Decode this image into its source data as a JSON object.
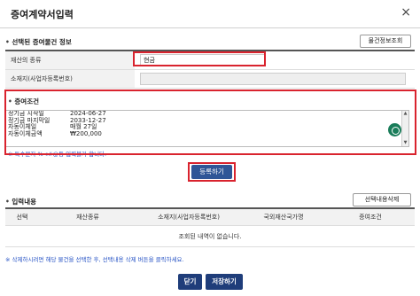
{
  "window": {
    "title": "증여계약서입력",
    "close_label": "×"
  },
  "selected_section": {
    "heading": "선택된 증여물건 정보",
    "lookup_button": "물건정보조회",
    "rows": [
      {
        "label": "재산의 종류",
        "value": "현금"
      },
      {
        "label": "소재지(사업자등록번호)",
        "value": ""
      }
    ]
  },
  "conditions_section": {
    "heading": "증여조건",
    "lines": [
      {
        "key": "정기금 시작일",
        "value": "2024-06-27"
      },
      {
        "key": "정기금 마지막일",
        "value": "2033-12-27"
      },
      {
        "key": "자동이체일",
        "value": "   매월 27일"
      },
      {
        "key": "자동이체금액",
        "value": "₩200,000"
      }
    ],
    "note": "※ 특수문자 %<#@등 입력불가 합니다."
  },
  "register_button": "등록하기",
  "input_section": {
    "heading": "입력내용",
    "delete_button": "선택내용삭제",
    "columns": [
      "선택",
      "재산종류",
      "소재지(사업자등록번호)",
      "국외재산국가명",
      "증여조건"
    ],
    "empty_message": "조회된 내역이 없습니다.",
    "note": "※ 삭제하시려면 해당 물건을 선택한 후, 선택내용 삭제 버튼을 클릭하세요."
  },
  "footer": {
    "close_button": "닫기",
    "save_button": "저장하기"
  },
  "colors": {
    "highlight": "#d9232e",
    "primary": "#2f5597",
    "note": "#2a56c6"
  }
}
